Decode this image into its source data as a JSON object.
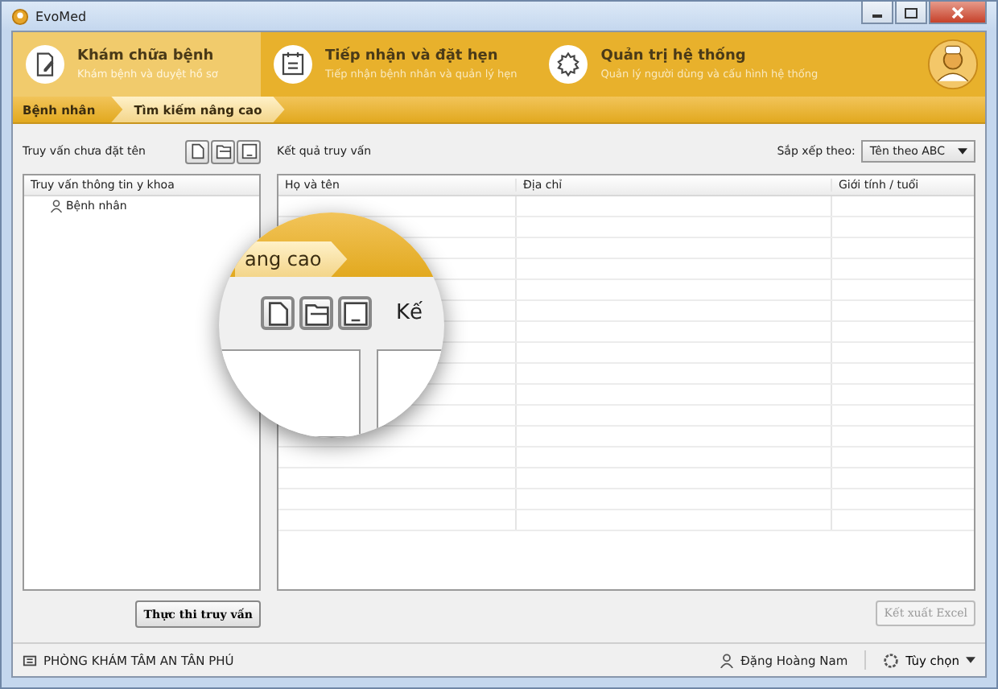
{
  "window": {
    "title": "EvoMed"
  },
  "modules": [
    {
      "kind": "exam",
      "title": "Khám chữa bệnh",
      "subtitle": "Khám bệnh và duyệt hồ sơ",
      "selected": true
    },
    {
      "kind": "calendar",
      "title": "Tiếp nhận và đặt hẹn",
      "subtitle": "Tiếp nhận bệnh nhân và quản lý hẹn",
      "selected": false
    },
    {
      "kind": "gear",
      "title": "Quản trị hệ thống",
      "subtitle": "Quản lý người dùng và cấu hình hệ thống",
      "selected": false
    }
  ],
  "breadcrumb": [
    {
      "label": "Bệnh nhân",
      "selected": false
    },
    {
      "label": "Tìm kiếm nâng cao",
      "selected": true
    }
  ],
  "query_panel": {
    "title": "Truy vấn chưa đặt tên",
    "tree_header": "Truy vấn thông tin y khoa",
    "tree": [
      {
        "label": "Bệnh nhân"
      }
    ],
    "run_button": "Thực thi truy vấn"
  },
  "results": {
    "title": "Kết quả truy vấn",
    "sort_label": "Sắp xếp theo:",
    "sort_value": "Tên theo ABC",
    "columns": [
      "Họ và tên",
      "Địa chỉ",
      "Giới tính / tuổi"
    ],
    "export_button": {
      "label": "Kết xuất Excel",
      "disabled": true
    }
  },
  "status_bar": {
    "clinic": "PHÒNG KHÁM TÂM AN TÂN PHÚ",
    "user": "Đặng Hoàng Nam",
    "options": "Tùy chọn"
  },
  "magnifier": {
    "breadcrumb_text": "ang cao",
    "label_text": "Kế"
  }
}
